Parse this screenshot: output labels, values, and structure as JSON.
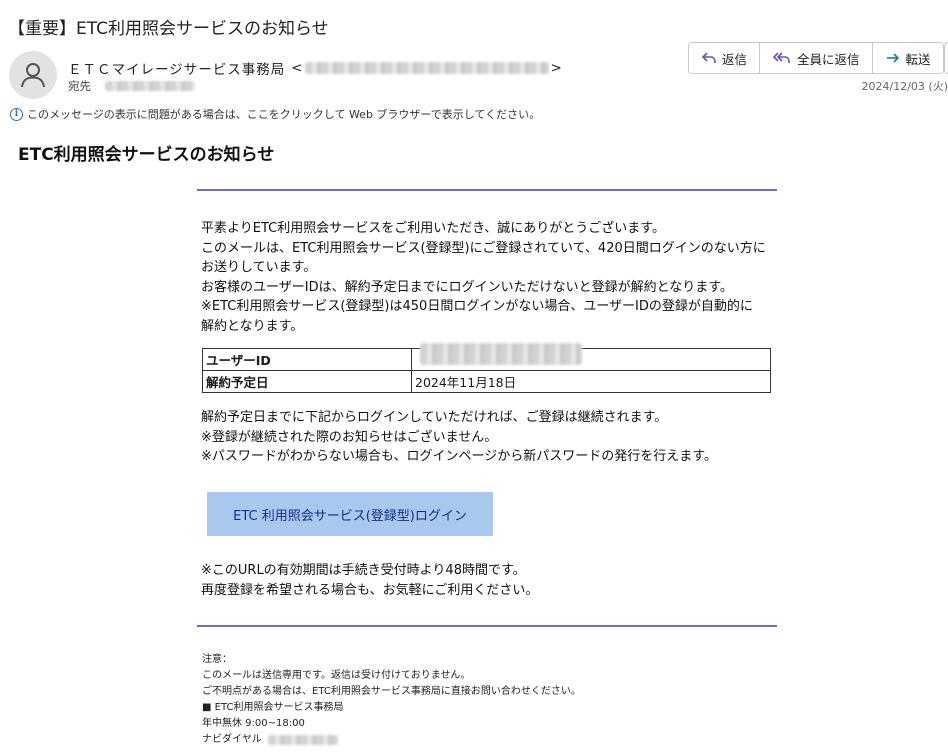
{
  "email": {
    "subject": "【重要】ETC利用照会サービスのお知らせ",
    "sender_name": "ＥＴＣマイレージサービス事務局",
    "sender_bracket_open": "<",
    "sender_bracket_close": ">",
    "recipient_label": "宛先",
    "date": "2024/12/03 (火)",
    "info_bar": "このメッセージの表示に問題がある場合は、ここをクリックして Web ブラウザーで表示してください。"
  },
  "actions": {
    "reply": "返信",
    "reply_all": "全員に返信",
    "forward": "転送"
  },
  "body": {
    "title": "ETC利用照会サービスのお知らせ",
    "paragraph1": [
      "平素よりETC利用照会サービスをご利用いただき、誠にありがとうございます。",
      "このメールは、ETC利用照会サービス(登録型)にご登録されていて、420日間ログインのない方に",
      "お送りしています。",
      "お客様のユーザーIDは、解約予定日までにログインいただけないと登録が解約となります。",
      "※ETC利用照会サービス(登録型)は450日間ログインがない場合、ユーザーIDの登録が自動的に",
      "解約となります。"
    ],
    "table": {
      "user_id_label": "ユーザーID",
      "cancel_date_label": "解約予定日",
      "cancel_date_value": "2024年11月18日"
    },
    "paragraph2": [
      "解約予定日までに下記からログインしていただければ、ご登録は継続されます。",
      "※登録が継続された際のお知らせはございません。",
      "※パスワードがわからない場合も、ログインページから新パスワードの発行を行えます。"
    ],
    "login_button": "ETC 利用照会サービス(登録型)ログイン",
    "paragraph3": [
      "※このURLの有効期間は手続き受付時より48時間です。",
      "再度登録を希望される場合も、お気軽にご利用ください。"
    ],
    "footer": {
      "note": "注意：",
      "line1": "このメールは送信専用です。返信は受け付けておりません。",
      "line2": "ご不明点がある場合は、ETC利用照会サービス事務局に直接お問い合わせください。",
      "line3": "■ ETC利用照会サービス事務局",
      "line4": "年中無休 9:00~18:00",
      "line5": "ナビダイヤル"
    }
  },
  "colors": {
    "rule": "#6b6bd6",
    "login_button_bg": "#a9c8ed",
    "login_button_text": "#1a2a8a",
    "info_icon": "#2f6fb5"
  },
  "icons": {
    "avatar": "person-icon",
    "reply": "reply-arrow-icon",
    "reply_all": "reply-all-arrow-icon",
    "forward": "forward-arrow-icon",
    "info": "info-icon"
  }
}
